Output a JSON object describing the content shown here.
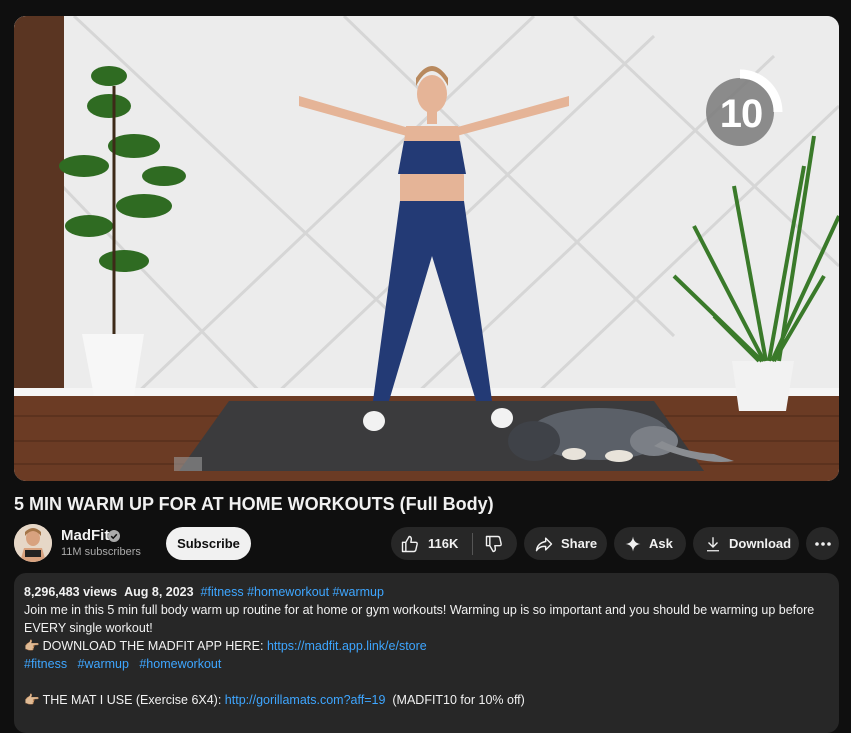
{
  "video": {
    "timer_value": "10"
  },
  "title": "5 MIN WARM UP FOR AT HOME WORKOUTS (Full Body)",
  "channel": {
    "name": "MadFit",
    "subscribers": "11M subscribers",
    "subscribe_label": "Subscribe"
  },
  "actions": {
    "like_count": "116K",
    "share_label": "Share",
    "ask_label": "Ask",
    "download_label": "Download"
  },
  "description": {
    "views": "8,296,483 views",
    "date": "Aug 8, 2023",
    "hashtags_top": "#fitness #homeworkout #warmup",
    "line1": "Join me in this 5 min full body warm up routine for at home or gym workouts! Warming up is so important and you should be warming up before",
    "line2": "EVERY single workout!",
    "download_prefix": "DOWNLOAD THE MADFIT APP HERE: ",
    "download_link": "https://madfit.app.link/e/store",
    "tag1": "#fitness",
    "tag2": "#warmup",
    "tag3": "#homeworkout",
    "mat_prefix": "THE MAT I USE (Exercise 6X4): ",
    "mat_link": "http://gorillamats.com?aff=19",
    "mat_suffix": "(MADFIT10 for 10% off)",
    "hand_emoji": "👉🏼"
  }
}
